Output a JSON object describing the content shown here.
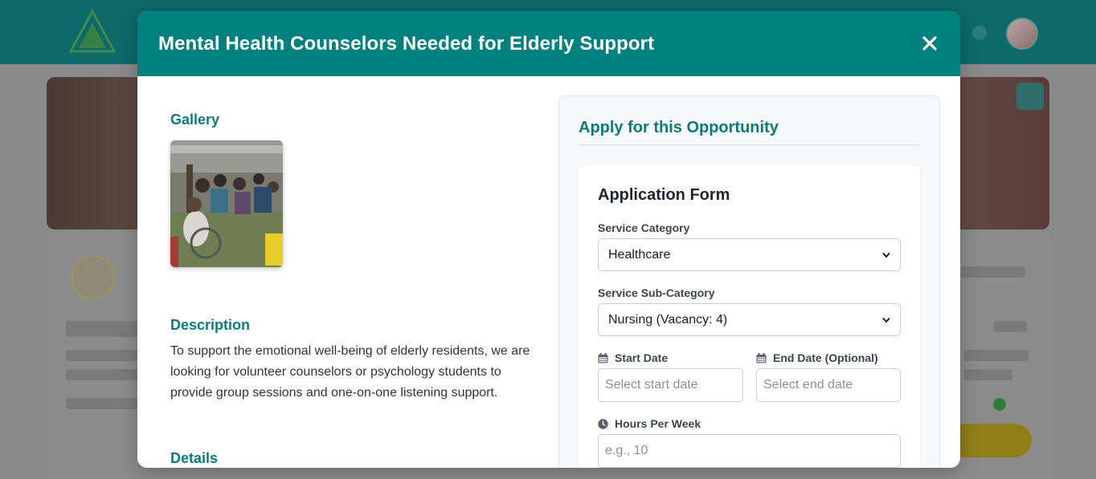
{
  "modal": {
    "title": "Mental Health Counselors Needed for Elderly Support",
    "close_icon": "close-icon"
  },
  "gallery": {
    "title": "Gallery"
  },
  "description": {
    "title": "Description",
    "text": "To support the emotional well-being of elderly residents, we are looking for volunteer counselors or psychology students to provide group sessions and one-on-one listening support."
  },
  "details": {
    "title": "Details"
  },
  "apply": {
    "title": "Apply for this Opportunity",
    "form": {
      "title": "Application Form",
      "service_category": {
        "label": "Service Category",
        "value": "Healthcare"
      },
      "service_sub_category": {
        "label": "Service Sub-Category",
        "value": "Nursing (Vacancy: 4)"
      },
      "start_date": {
        "label": "Start Date",
        "placeholder": "Select start date",
        "icon": "calendar-icon"
      },
      "end_date": {
        "label": "End Date (Optional)",
        "placeholder": "Select end date",
        "icon": "calendar-icon"
      },
      "hours_per_week": {
        "label": "Hours Per Week",
        "placeholder": "e.g., 10",
        "icon": "clock-icon"
      }
    }
  },
  "colors": {
    "teal": "#00807f",
    "heading_teal": "#0b7b7a"
  }
}
